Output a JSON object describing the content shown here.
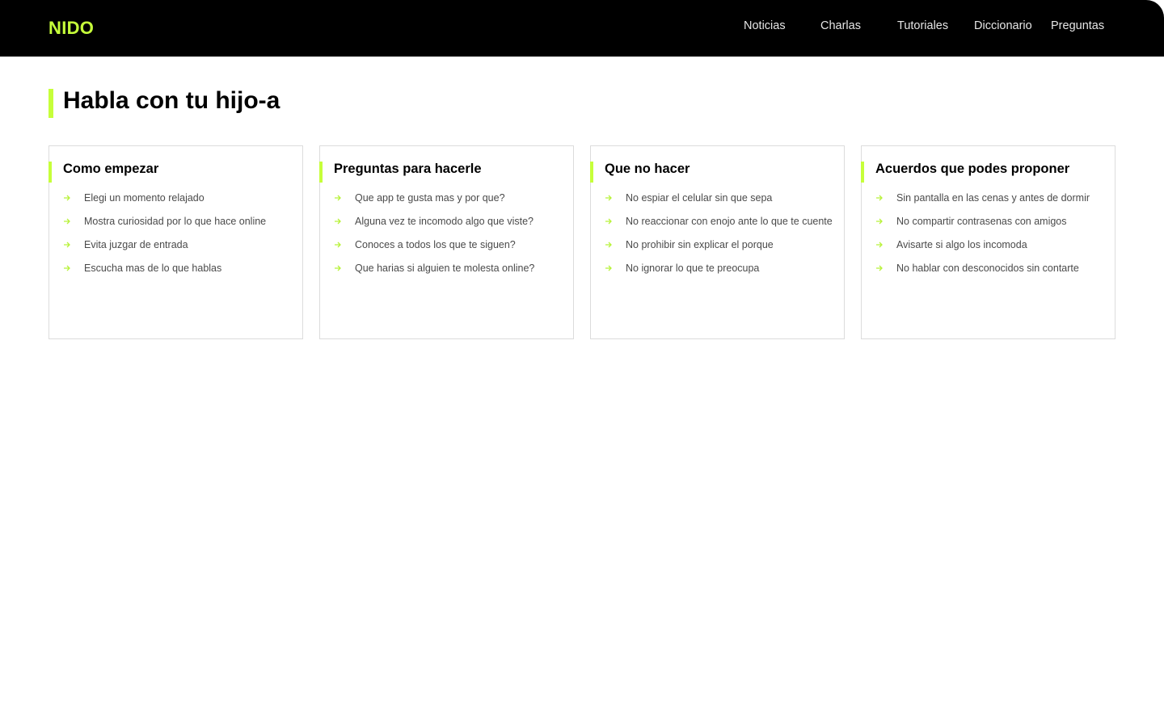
{
  "nav": {
    "brand": "NIDO",
    "items": [
      {
        "label": "Noticias"
      },
      {
        "label": "Charlas"
      },
      {
        "label": "Tutoriales"
      },
      {
        "label": "Diccionario"
      },
      {
        "label": "Preguntas"
      }
    ]
  },
  "page": {
    "title": "Habla con tu hijo-a"
  },
  "cards": [
    {
      "title": "Como empezar",
      "items": [
        "Elegi un momento relajado",
        "Mostra curiosidad por lo que hace online",
        "Evita juzgar de entrada",
        "Escucha mas de lo que hablas"
      ]
    },
    {
      "title": "Preguntas para hacerle",
      "items": [
        "Que app te gusta mas y por que?",
        "Alguna vez te incomodo algo que viste?",
        "Conoces a todos los que te siguen?",
        "Que harias si alguien te molesta online?"
      ]
    },
    {
      "title": "Que no hacer",
      "items": [
        "No espiar el celular sin que sepa",
        "No reaccionar con enojo ante lo que te cuente",
        "No prohibir sin explicar el porque",
        "No ignorar lo que te preocupa"
      ]
    },
    {
      "title": "Acuerdos que podes proponer",
      "items": [
        "Sin pantalla en las cenas y antes de dormir",
        "No compartir contrasenas con amigos",
        "Avisarte si algo los incomoda",
        "No hablar con desconocidos sin contarte"
      ]
    }
  ],
  "icons": {
    "list_bullet": "arrow-right-icon"
  },
  "colors": {
    "accent": "#c6ff3a",
    "navbar_bg": "#000000",
    "nav_text": "#e6e6e6",
    "body_text": "#4a4a4a",
    "card_border": "#dcdcdc"
  }
}
